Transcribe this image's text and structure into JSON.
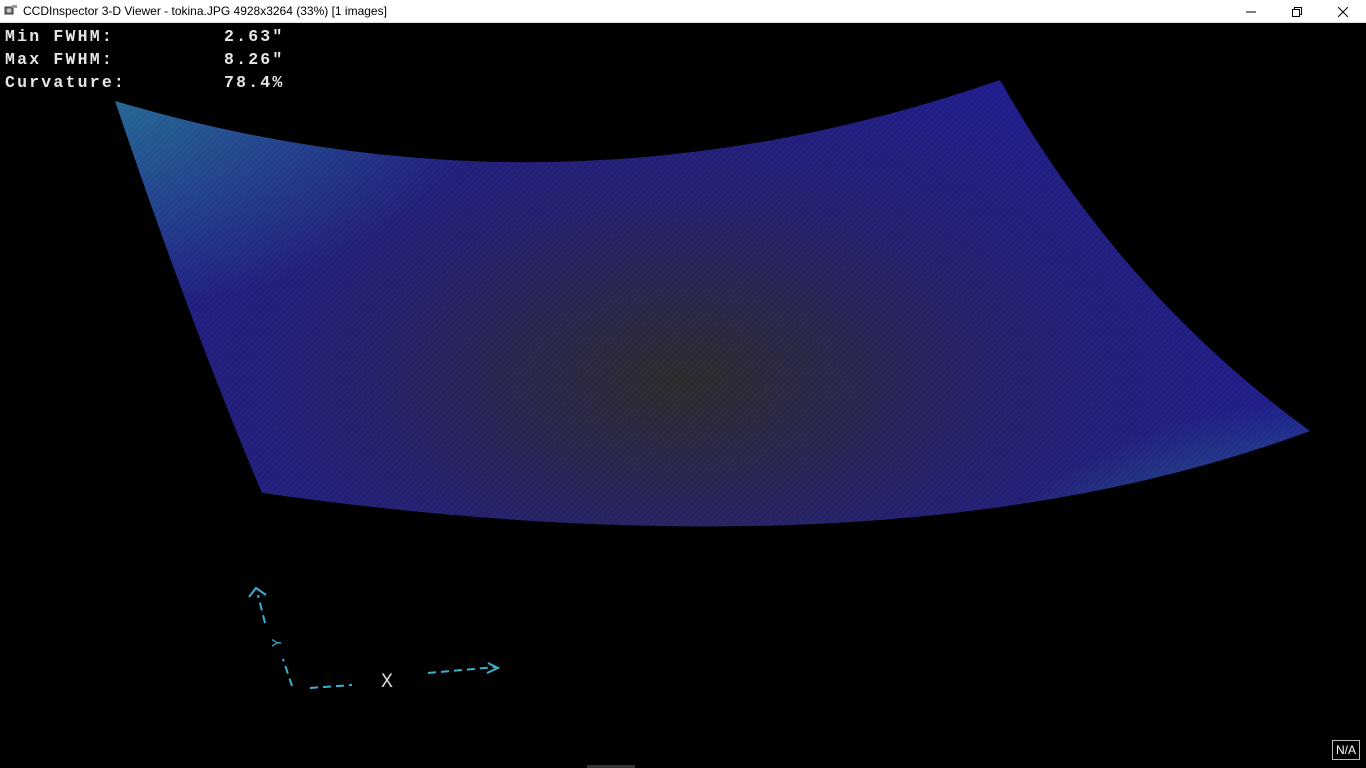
{
  "window": {
    "title": "CCDInspector 3-D Viewer - tokina.JPG 4928x3264 (33%)  [1 images]",
    "icon": "ccdinspector-app-icon",
    "controls": [
      "minimize-icon",
      "restore-icon",
      "close-icon"
    ]
  },
  "readout": {
    "min_fwhm_label": "Min FWHM:",
    "min_fwhm_value": "2.63\"",
    "max_fwhm_label": "Max FWHM:",
    "max_fwhm_value": "8.26\"",
    "curvature_label": "Curvature:",
    "curvature_value": "78.4%"
  },
  "axes": {
    "x_label": "X",
    "y_label": "Y"
  },
  "status_badge": "N/A",
  "colors": {
    "background": "#000000",
    "surface_low": "#2a2a2a",
    "surface_mid": "#26207a",
    "surface_high": "#1e7a6e",
    "surface_peak": "#8a5050",
    "axis_color": "#3ab0d0"
  }
}
